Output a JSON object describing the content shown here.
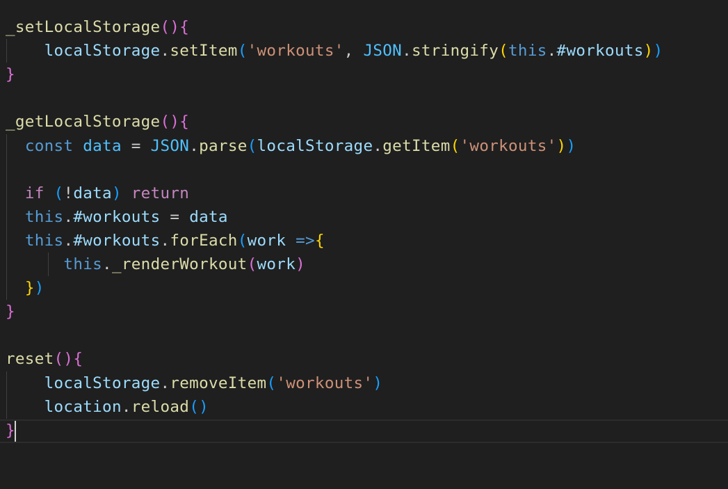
{
  "editor": {
    "lines": [
      [
        {
          "t": "_setLocalStorage",
          "c": "fn"
        },
        {
          "t": "(){",
          "c": "b1"
        }
      ],
      [
        {
          "t": "    ",
          "c": "punc"
        },
        {
          "t": "localStorage",
          "c": "var"
        },
        {
          "t": ".",
          "c": "punc"
        },
        {
          "t": "setItem",
          "c": "fn"
        },
        {
          "t": "(",
          "c": "b2"
        },
        {
          "t": "'workouts'",
          "c": "str"
        },
        {
          "t": ", ",
          "c": "punc"
        },
        {
          "t": "JSON",
          "c": "obj"
        },
        {
          "t": ".",
          "c": "punc"
        },
        {
          "t": "stringify",
          "c": "fn"
        },
        {
          "t": "(",
          "c": "b3"
        },
        {
          "t": "this",
          "c": "kw"
        },
        {
          "t": ".",
          "c": "punc"
        },
        {
          "t": "#workouts",
          "c": "var"
        },
        {
          "t": ")",
          "c": "b3"
        },
        {
          "t": ")",
          "c": "b2"
        }
      ],
      [
        {
          "t": "}",
          "c": "b1"
        }
      ],
      [],
      [
        {
          "t": "_getLocalStorage",
          "c": "fn"
        },
        {
          "t": "(){",
          "c": "b1"
        }
      ],
      [
        {
          "t": "  ",
          "c": "punc"
        },
        {
          "t": "const",
          "c": "kw"
        },
        {
          "t": " ",
          "c": "punc"
        },
        {
          "t": "data",
          "c": "obj"
        },
        {
          "t": " = ",
          "c": "punc"
        },
        {
          "t": "JSON",
          "c": "obj"
        },
        {
          "t": ".",
          "c": "punc"
        },
        {
          "t": "parse",
          "c": "fn"
        },
        {
          "t": "(",
          "c": "b2"
        },
        {
          "t": "localStorage",
          "c": "var"
        },
        {
          "t": ".",
          "c": "punc"
        },
        {
          "t": "getItem",
          "c": "fn"
        },
        {
          "t": "(",
          "c": "b3"
        },
        {
          "t": "'workouts'",
          "c": "str"
        },
        {
          "t": ")",
          "c": "b3"
        },
        {
          "t": ")",
          "c": "b2"
        }
      ],
      [],
      [
        {
          "t": "  ",
          "c": "punc"
        },
        {
          "t": "if",
          "c": "ctrl"
        },
        {
          "t": " ",
          "c": "punc"
        },
        {
          "t": "(",
          "c": "b2"
        },
        {
          "t": "!",
          "c": "punc"
        },
        {
          "t": "data",
          "c": "var"
        },
        {
          "t": ")",
          "c": "b2"
        },
        {
          "t": " ",
          "c": "punc"
        },
        {
          "t": "return",
          "c": "ctrl"
        }
      ],
      [
        {
          "t": "  ",
          "c": "punc"
        },
        {
          "t": "this",
          "c": "kw"
        },
        {
          "t": ".",
          "c": "punc"
        },
        {
          "t": "#workouts",
          "c": "var"
        },
        {
          "t": " = ",
          "c": "punc"
        },
        {
          "t": "data",
          "c": "var"
        }
      ],
      [
        {
          "t": "  ",
          "c": "punc"
        },
        {
          "t": "this",
          "c": "kw"
        },
        {
          "t": ".",
          "c": "punc"
        },
        {
          "t": "#workouts",
          "c": "var"
        },
        {
          "t": ".",
          "c": "punc"
        },
        {
          "t": "forEach",
          "c": "fn"
        },
        {
          "t": "(",
          "c": "b2"
        },
        {
          "t": "work",
          "c": "var"
        },
        {
          "t": " ",
          "c": "punc"
        },
        {
          "t": "=>",
          "c": "kw"
        },
        {
          "t": "{",
          "c": "b3"
        }
      ],
      [
        {
          "t": "      ",
          "c": "punc"
        },
        {
          "t": "this",
          "c": "kw"
        },
        {
          "t": ".",
          "c": "punc"
        },
        {
          "t": "_renderWorkout",
          "c": "fn"
        },
        {
          "t": "(",
          "c": "b1"
        },
        {
          "t": "work",
          "c": "var"
        },
        {
          "t": ")",
          "c": "b1"
        }
      ],
      [
        {
          "t": "  ",
          "c": "punc"
        },
        {
          "t": "}",
          "c": "b3"
        },
        {
          "t": ")",
          "c": "b2"
        }
      ],
      [
        {
          "t": "}",
          "c": "b1"
        }
      ],
      [],
      [
        {
          "t": "reset",
          "c": "fn"
        },
        {
          "t": "(){",
          "c": "b1"
        }
      ],
      [
        {
          "t": "    ",
          "c": "punc"
        },
        {
          "t": "localStorage",
          "c": "var"
        },
        {
          "t": ".",
          "c": "punc"
        },
        {
          "t": "removeItem",
          "c": "fn"
        },
        {
          "t": "(",
          "c": "b2"
        },
        {
          "t": "'workouts'",
          "c": "str"
        },
        {
          "t": ")",
          "c": "b2"
        }
      ],
      [
        {
          "t": "    ",
          "c": "punc"
        },
        {
          "t": "location",
          "c": "var"
        },
        {
          "t": ".",
          "c": "punc"
        },
        {
          "t": "reload",
          "c": "fn"
        },
        {
          "t": "()",
          "c": "b2"
        }
      ],
      [
        {
          "t": "}",
          "c": "b1"
        }
      ]
    ]
  },
  "colors": {
    "background": "#1f1f1f",
    "function": "#dcdcaa",
    "variable": "#9cdcfe",
    "string": "#ce9178",
    "keyword": "#569cd6",
    "control": "#c586c0",
    "constant": "#4fc1ff",
    "bracket_level_1": "#da70d6",
    "bracket_level_2": "#179fff",
    "bracket_level_3": "#ffd700"
  }
}
